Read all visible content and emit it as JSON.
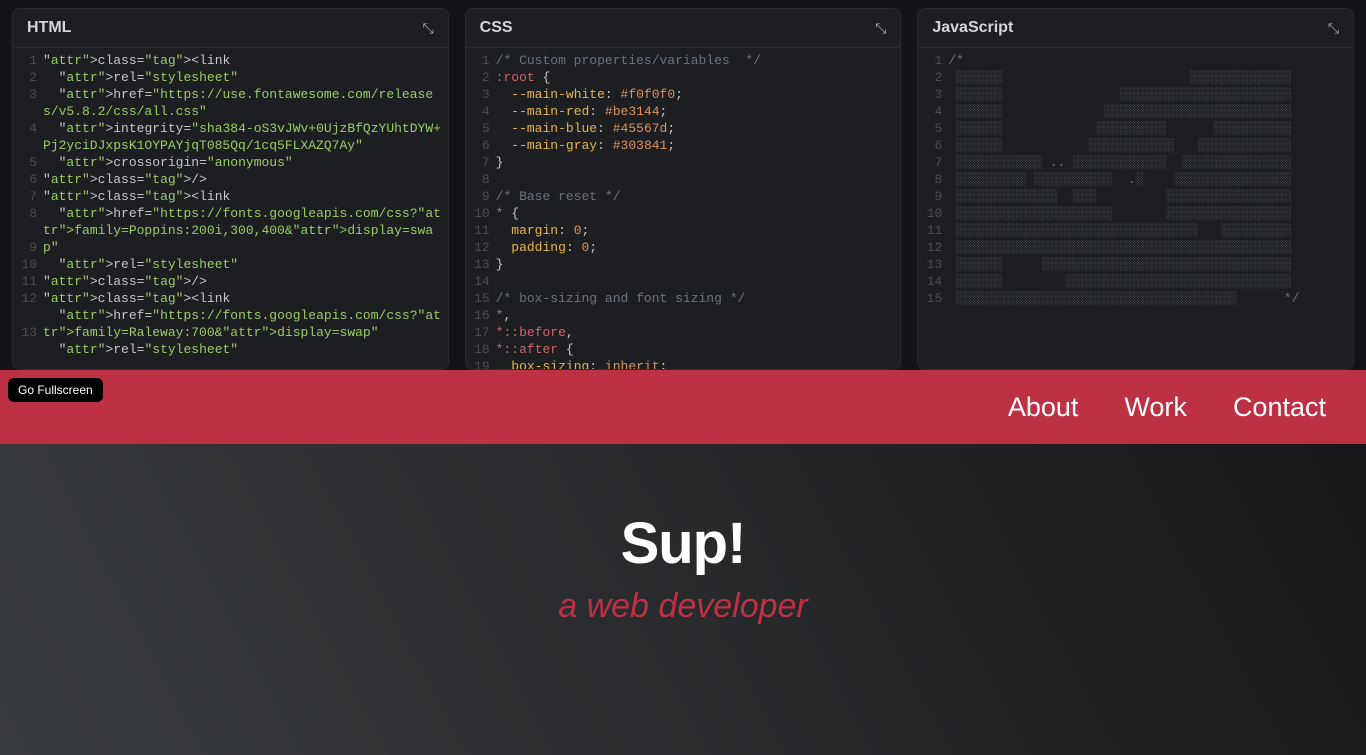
{
  "panels": {
    "html": {
      "title": "HTML",
      "lines": [
        {
          "n": 1,
          "t": "tag",
          "c": "<link"
        },
        {
          "n": 2,
          "t": "attr",
          "c": "  rel=\"stylesheet\""
        },
        {
          "n": 3,
          "t": "wrap",
          "c": "  href=\"https://use.fontawesome.com/releases/v5.8.2/css/all.css\""
        },
        {
          "n": 4,
          "t": "wrap",
          "c": "  integrity=\"sha384-oS3vJWv+0UjzBfQzYUhtDYW+Pj2yciDJxpsK1OYPAYjqT085Qq/1cq5FLXAZQ7Ay\""
        },
        {
          "n": 5,
          "t": "attr",
          "c": "  crossorigin=\"anonymous\""
        },
        {
          "n": 6,
          "t": "tag",
          "c": "/>"
        },
        {
          "n": 7,
          "t": "tag",
          "c": "<link"
        },
        {
          "n": 8,
          "t": "wrap",
          "c": "  href=\"https://fonts.googleapis.com/css?family=Poppins:200i,300,400&display=swap\""
        },
        {
          "n": 9,
          "t": "attr",
          "c": "  rel=\"stylesheet\""
        },
        {
          "n": 10,
          "t": "tag",
          "c": "/>"
        },
        {
          "n": 11,
          "t": "tag",
          "c": "<link"
        },
        {
          "n": 12,
          "t": "wrap",
          "c": "  href=\"https://fonts.googleapis.com/css?family=Raleway:700&display=swap\""
        },
        {
          "n": 13,
          "t": "attr",
          "c": "  rel=\"stylesheet\""
        }
      ]
    },
    "css": {
      "title": "CSS",
      "lines": [
        {
          "n": 1,
          "c": "/* Custom properties/variables  */",
          "cls": "com"
        },
        {
          "n": 2,
          "c": ":root {",
          "cls": "psel"
        },
        {
          "n": 3,
          "c": "  --main-white: #f0f0f0;",
          "cls": "decl"
        },
        {
          "n": 4,
          "c": "  --main-red: #be3144;",
          "cls": "decl"
        },
        {
          "n": 5,
          "c": "  --main-blue: #45567d;",
          "cls": "decl"
        },
        {
          "n": 6,
          "c": "  --main-gray: #303841;",
          "cls": "decl"
        },
        {
          "n": 7,
          "c": "}",
          "cls": "punc"
        },
        {
          "n": 8,
          "c": "",
          "cls": ""
        },
        {
          "n": 9,
          "c": "/* Base reset */",
          "cls": "com"
        },
        {
          "n": 10,
          "c": "* {",
          "cls": "sel"
        },
        {
          "n": 11,
          "c": "  margin: 0;",
          "cls": "decl2"
        },
        {
          "n": 12,
          "c": "  padding: 0;",
          "cls": "decl2"
        },
        {
          "n": 13,
          "c": "}",
          "cls": "punc"
        },
        {
          "n": 14,
          "c": "",
          "cls": ""
        },
        {
          "n": 15,
          "c": "/* box-sizing and font sizing */",
          "cls": "com"
        },
        {
          "n": 16,
          "c": "*,",
          "cls": "sel"
        },
        {
          "n": 17,
          "c": "*::before,",
          "cls": "sel"
        },
        {
          "n": 18,
          "c": "*::after {",
          "cls": "sel"
        },
        {
          "n": 19,
          "c": "  box-sizing: inherit;",
          "cls": "decl2"
        }
      ]
    },
    "js": {
      "title": "JavaScript",
      "lines": 15
    }
  },
  "preview": {
    "fullscreen_label": "Go Fullscreen",
    "nav": [
      "About",
      "Work",
      "Contact"
    ],
    "hero_title": "Sup!",
    "hero_sub": "a web developer"
  }
}
